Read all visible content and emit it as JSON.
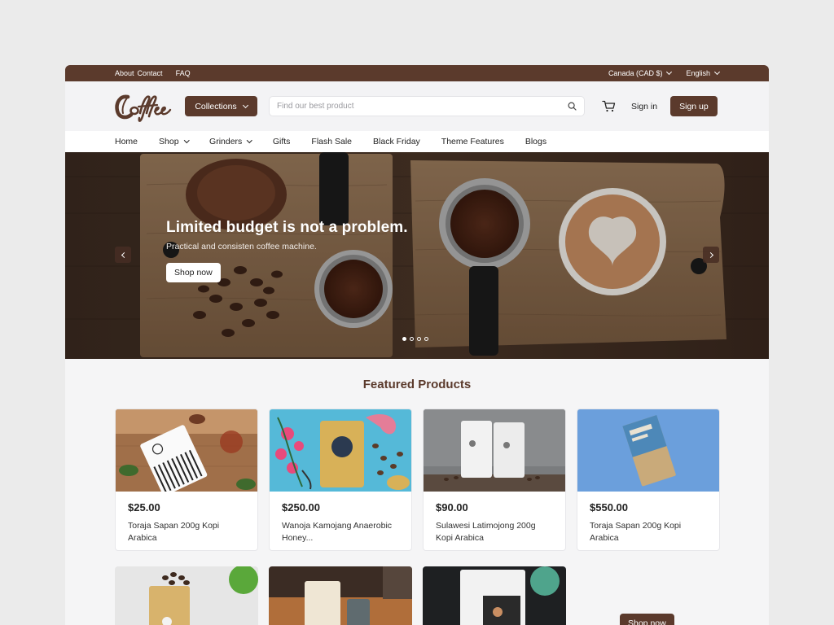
{
  "topbar": {
    "links": [
      "About",
      "Contact"
    ],
    "faq": "FAQ",
    "currency": "Canada (CAD $)",
    "language": "English"
  },
  "header": {
    "logo_text": "Coffee",
    "collections_label": "Collections",
    "search_placeholder": "Find our best product",
    "signin_label": "Sign in",
    "signup_label": "Sign up"
  },
  "nav": {
    "items": [
      {
        "label": "Home",
        "dropdown": false
      },
      {
        "label": "Shop",
        "dropdown": true
      },
      {
        "label": "Grinders",
        "dropdown": true
      },
      {
        "label": "Gifts",
        "dropdown": false
      },
      {
        "label": "Flash Sale",
        "dropdown": false
      },
      {
        "label": "Black Friday",
        "dropdown": false
      },
      {
        "label": "Theme Features",
        "dropdown": false
      },
      {
        "label": "Blogs",
        "dropdown": false
      }
    ]
  },
  "hero": {
    "title": "Limited budget is not a problem.",
    "subtitle": "Practical and consisten coffee machine.",
    "button": "Shop now",
    "slides": 4,
    "active_slide": 1
  },
  "featured": {
    "title": "Featured Products",
    "products": [
      {
        "price": "$25.00",
        "name": "Toraja Sapan 200g Kopi Arabica"
      },
      {
        "price": "$250.00",
        "name": "Wanoja Kamojang Anaerobic Honey..."
      },
      {
        "price": "$90.00",
        "name": "Sulawesi Latimojong 200g Kopi Arabica"
      },
      {
        "price": "$550.00",
        "name": "Toraja Sapan 200g Kopi Arabica"
      }
    ],
    "more_button": "Shop now"
  },
  "colors": {
    "brand": "#5b3a2c",
    "background": "#f5f5f6"
  }
}
